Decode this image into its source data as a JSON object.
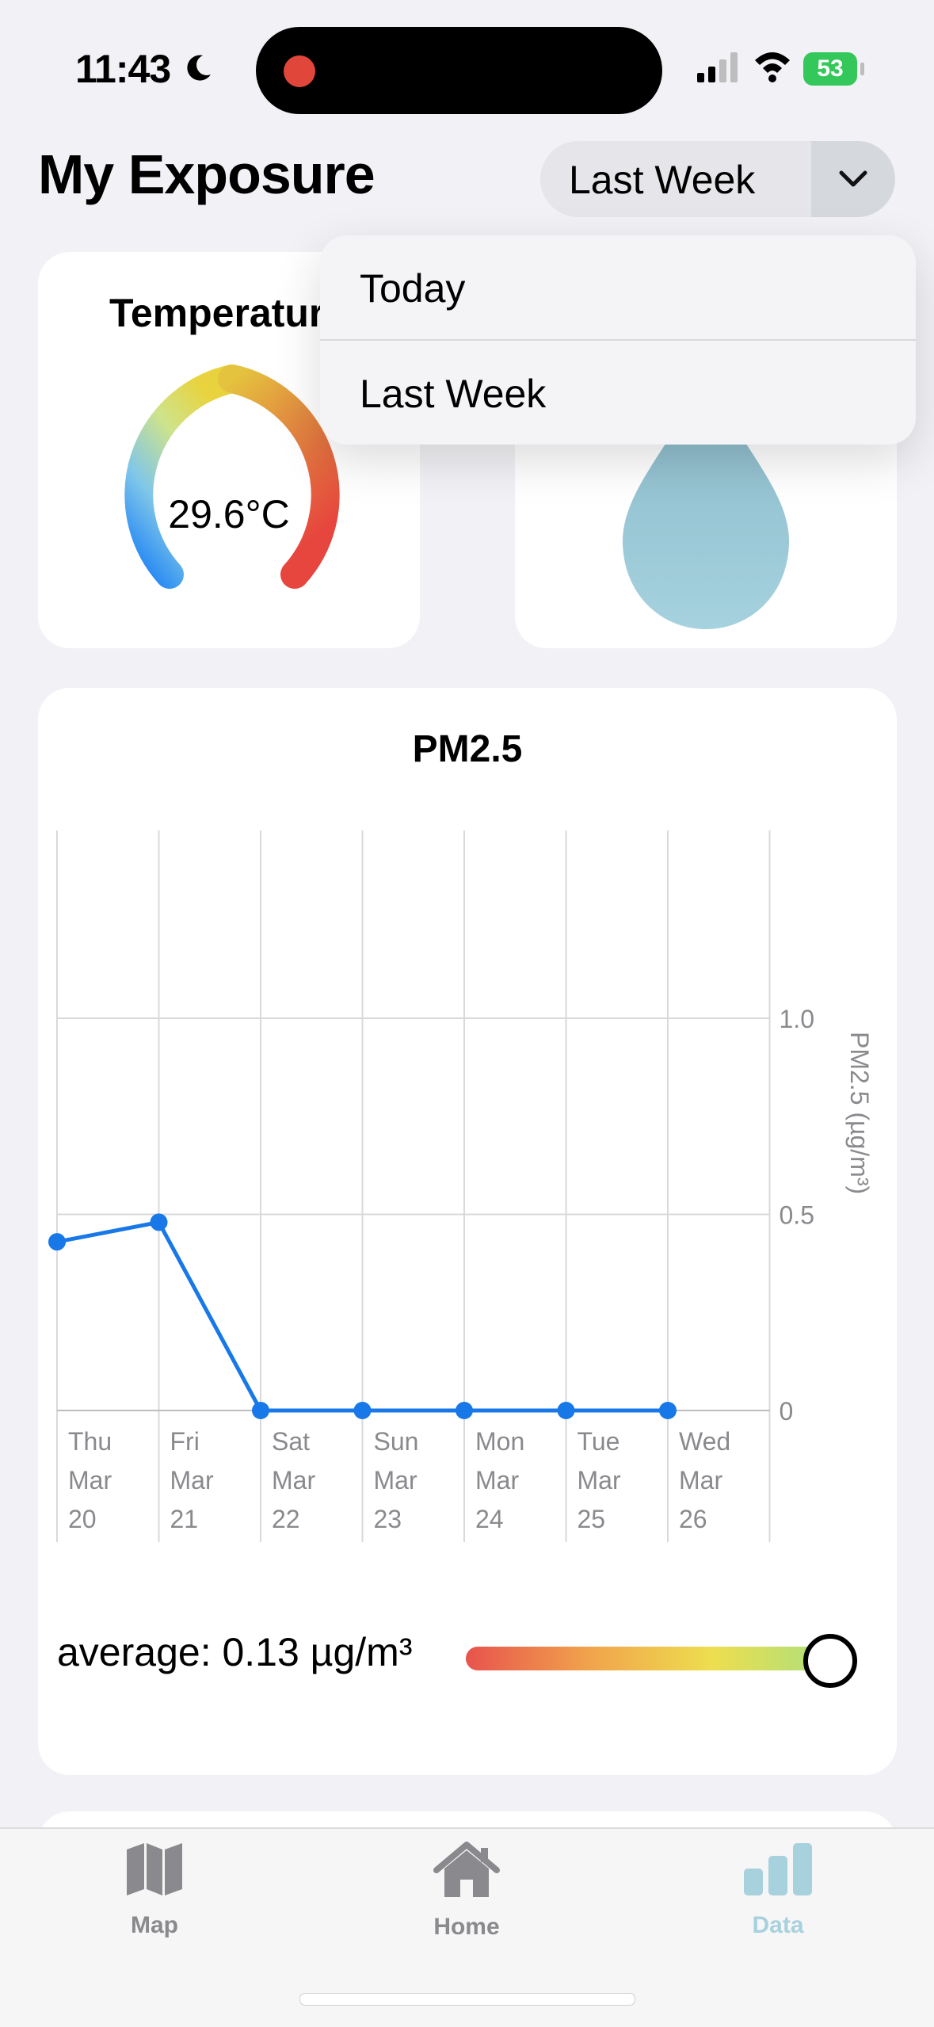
{
  "status": {
    "time": "11:43",
    "battery": "53"
  },
  "header": {
    "title": "My Exposure",
    "period_selected": "Last Week"
  },
  "dropdown": {
    "options": [
      "Today",
      "Last Week"
    ]
  },
  "temperature": {
    "title": "Temperature",
    "value": "29.6°C",
    "gauge_fraction": 0.8
  },
  "pm25": {
    "title": "PM2.5",
    "average_text": "average: 0.13 µg/m³",
    "level_fraction": 0.99
  },
  "tabs": [
    {
      "label": "Map",
      "icon": "map-icon"
    },
    {
      "label": "Home",
      "icon": "house-icon"
    },
    {
      "label": "Data",
      "icon": "chart-bars-icon"
    }
  ],
  "colors": {
    "accent_blue": "#1878e8",
    "tab_active": "#a8d1de",
    "drop": "#a2ccd8"
  },
  "chart_data": {
    "type": "line",
    "title": "PM2.5",
    "ylabel": "PM2.5 (µg/m³)",
    "xlabel": "",
    "categories": [
      [
        "Thu",
        "Mar",
        "20"
      ],
      [
        "Fri",
        "Mar",
        "21"
      ],
      [
        "Sat",
        "Mar",
        "22"
      ],
      [
        "Sun",
        "Mar",
        "23"
      ],
      [
        "Mon",
        "Mar",
        "24"
      ],
      [
        "Tue",
        "Mar",
        "25"
      ],
      [
        "Wed",
        "Mar",
        "26"
      ]
    ],
    "values": [
      0.43,
      0.48,
      0,
      0,
      0,
      0,
      0
    ],
    "y_ticks": [
      "0",
      "0.5",
      "1.0"
    ],
    "ylim": [
      0,
      1.5
    ],
    "grid": true,
    "y_axis_side": "right"
  }
}
